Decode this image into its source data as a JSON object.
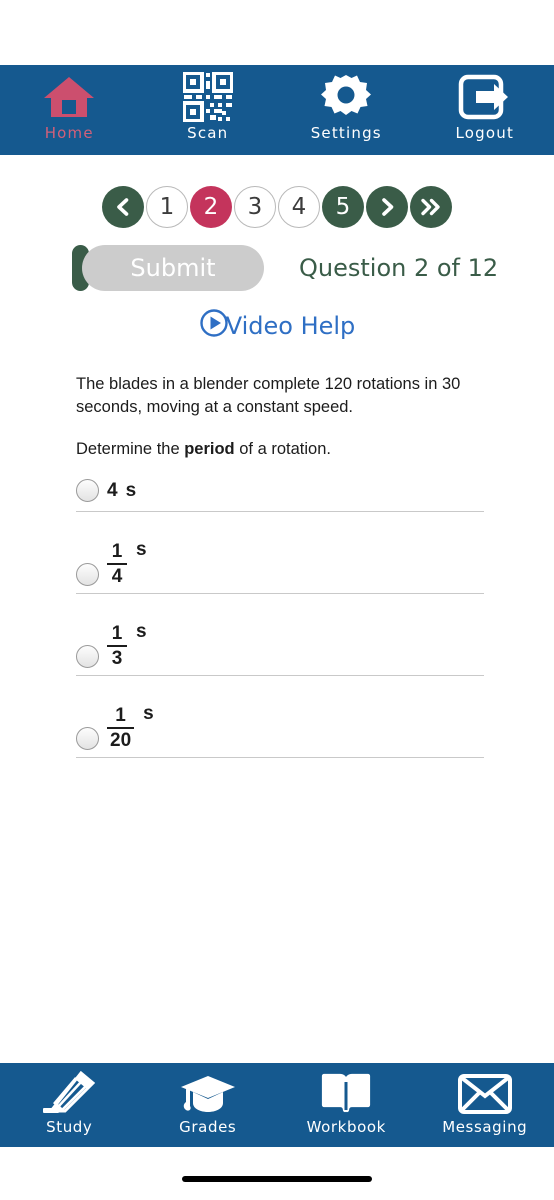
{
  "topnav": {
    "items": [
      {
        "label": "Home",
        "icon": "home-icon"
      },
      {
        "label": "Scan",
        "icon": "qr-code-icon"
      },
      {
        "label": "Settings",
        "icon": "gear-icon"
      },
      {
        "label": "Logout",
        "icon": "logout-icon"
      }
    ]
  },
  "pager": {
    "prev_icon": "chevron-left-icon",
    "next_icon": "chevron-right-icon",
    "last_icon": "double-chevron-right-icon",
    "pages": [
      {
        "label": "1",
        "state": "plain"
      },
      {
        "label": "2",
        "state": "active"
      },
      {
        "label": "3",
        "state": "plain"
      },
      {
        "label": "4",
        "state": "plain"
      },
      {
        "label": "5",
        "state": "green"
      }
    ]
  },
  "toolbar": {
    "submit_label": "Submit",
    "question_counter": "Question 2 of 12",
    "video_help_label": "Video Help",
    "video_help_icon": "play-circle-icon"
  },
  "question": {
    "stem_line1": "The blades in a blender complete 120 rotations in 30 seconds, moving at a constant speed.",
    "prompt_before": "Determine the ",
    "prompt_bold": "period",
    "prompt_after": " of a rotation.",
    "options": [
      {
        "kind": "plain",
        "value": "4",
        "unit": "s"
      },
      {
        "kind": "fraction",
        "numerator": "1",
        "denominator": "4",
        "unit": "s"
      },
      {
        "kind": "fraction",
        "numerator": "1",
        "denominator": "3",
        "unit": "s"
      },
      {
        "kind": "fraction",
        "numerator": "1",
        "denominator": "20",
        "unit": "s"
      }
    ]
  },
  "bottomnav": {
    "items": [
      {
        "label": "Study",
        "icon": "pencil-icon"
      },
      {
        "label": "Grades",
        "icon": "graduation-cap-icon"
      },
      {
        "label": "Workbook",
        "icon": "open-book-icon"
      },
      {
        "label": "Messaging",
        "icon": "envelope-icon"
      }
    ]
  },
  "colors": {
    "nav_blue": "#15598f",
    "accent_green": "#3a5c48",
    "active_crimson": "#c4345c",
    "home_icon_red": "#cc4f6e",
    "link_blue": "#2f6fc4"
  }
}
